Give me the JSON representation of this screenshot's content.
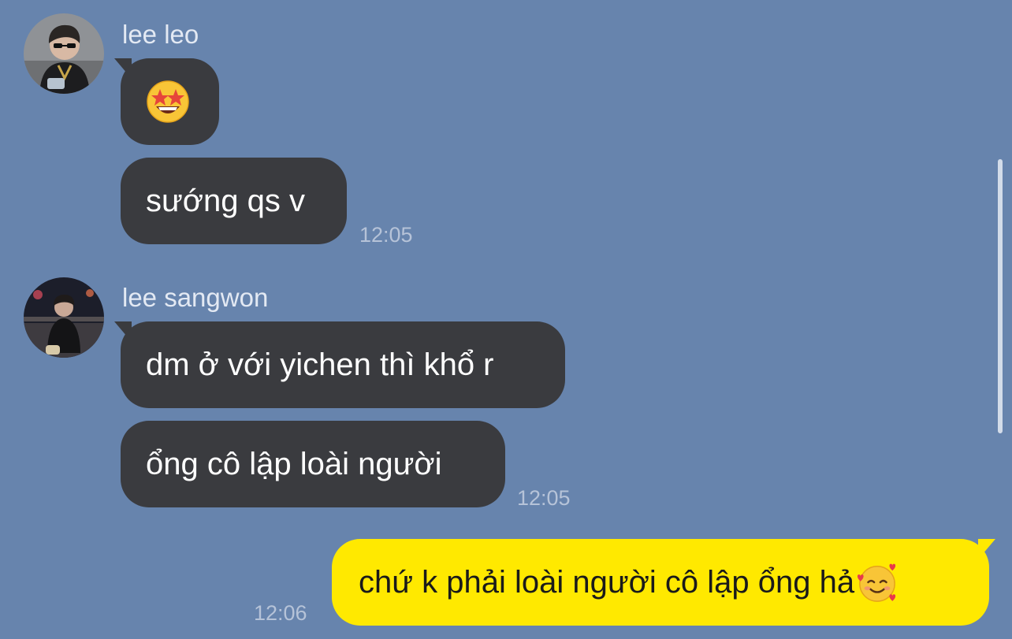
{
  "messages": [
    {
      "sender": "lee leo",
      "avatar": "avatar-lee-leo",
      "bubbles": [
        {
          "type": "emoji",
          "icon": "star-struck-emoji-icon"
        },
        {
          "type": "text",
          "text": "sướng qs v"
        }
      ],
      "time": "12:05"
    },
    {
      "sender": "lee sangwon",
      "avatar": "avatar-lee-sangwon",
      "bubbles": [
        {
          "type": "text",
          "text": "dm ở với yichen thì khổ r"
        },
        {
          "type": "text",
          "text": "ổng cô lập loài người"
        }
      ],
      "time": "12:05"
    },
    {
      "sender": "me",
      "bubbles": [
        {
          "type": "text",
          "text": "chứ k phải loài người cô lập ổng hả",
          "trailing_icon": "smiling-face-with-hearts-emoji-icon"
        }
      ],
      "time": "12:06"
    }
  ],
  "colors": {
    "background": "#6784ad",
    "incoming_bubble": "#3a3b3f",
    "outgoing_bubble": "#ffe900"
  }
}
